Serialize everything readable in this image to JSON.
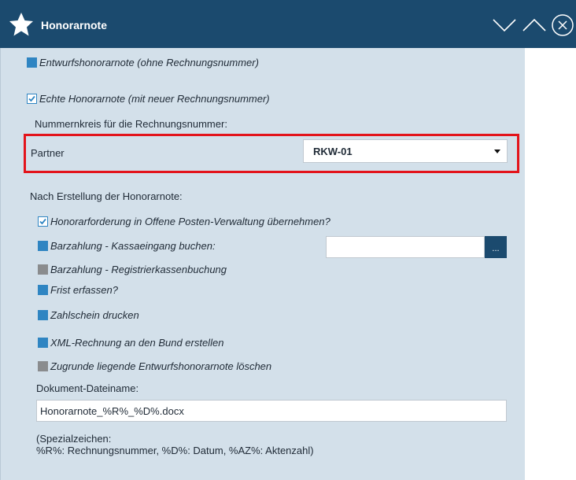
{
  "window": {
    "title": "Honorarnote"
  },
  "options": {
    "draft": {
      "label": "Entwurfshonorarnote (ohne Rechnungsnummer)",
      "checked": false
    },
    "real": {
      "label": "Echte Honorarnote (mit neuer Rechnungsnummer)",
      "checked": true
    }
  },
  "numbering": {
    "label": "Nummernkreis für die Rechnungsnummer:",
    "partner_label": "Partner",
    "partner_value": "RKW-01"
  },
  "after": {
    "label": "Nach Erstellung der Honorarnote:",
    "items": [
      {
        "label": "Honorarforderung in Offene Posten-Verwaltung übernehmen?",
        "checked": true,
        "enabled": true
      },
      {
        "label": "Barzahlung - Kassaeingang buchen:",
        "checked": false,
        "enabled": true
      },
      {
        "label": "Barzahlung - Registrierkassenbuchung",
        "checked": false,
        "enabled": false
      },
      {
        "label": "Frist erfassen?",
        "checked": false,
        "enabled": true
      },
      {
        "label": "Zahlschein drucken",
        "checked": false,
        "enabled": true
      },
      {
        "label": "XML-Rechnung an den Bund erstellen",
        "checked": false,
        "enabled": true
      },
      {
        "label": "Zugrunde liegende Entwurfshonorarnote löschen",
        "checked": false,
        "enabled": false
      }
    ],
    "cash_account_value": "",
    "browse_label": "..."
  },
  "document": {
    "label": "Dokument-Dateiname:",
    "filename": "Honorarnote_%R%_%D%.docx",
    "hint_line1": "(Spezialzeichen:",
    "hint_line2": "%R%: Rechnungsnummer, %D%: Datum, %AZ%: Aktenzahl)"
  },
  "colors": {
    "titlebar": "#1b4a6e",
    "panel": "#d3e0ea",
    "checkbox_blue": "#2f85c2",
    "checkbox_gray": "#8a8c8e",
    "highlight": "#e3141b"
  }
}
